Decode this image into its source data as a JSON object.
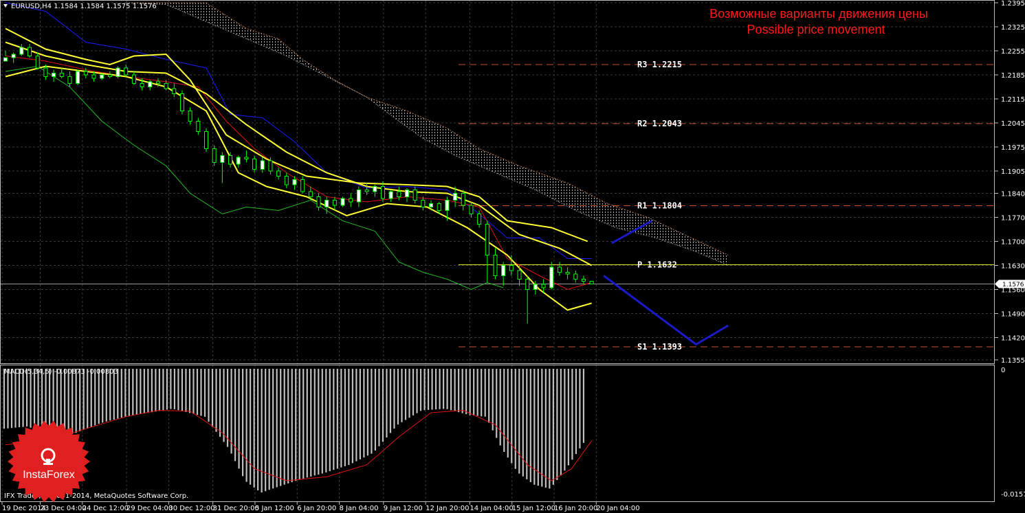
{
  "window": {
    "symbol_title": "EURUSD,H4  1.1584 1.1584 1.1575 1.1576",
    "copyright": "IFX Trader, © 2001-2014, MetaQuotes Software Corp."
  },
  "annotation": {
    "line_ru": "Возможные варианты движения цены",
    "line_en": "Possible price movement"
  },
  "logo": {
    "text": "InstaForex"
  },
  "chart_data": [
    {
      "type": "candlestick",
      "title": "EURUSD,H4  1.1584 1.1584 1.1575 1.1576",
      "x_tick_labels": [
        "19 Dec 2014",
        "23 Dec 04:00",
        "24 Dec 12:00",
        "29 Dec 04:00",
        "30 Dec 12:00",
        "31 Dec 20:00",
        "5 Jan 12:00",
        "6 Jan 20:00",
        "8 Jan 04:00",
        "9 Jan 12:00",
        "12 Jan 20:00",
        "14 Jan 04:00",
        "15 Jan 12:00",
        "16 Jan 20:00",
        "20 Jan 04:00"
      ],
      "y_tick_labels": [
        "1.2395",
        "1.2325",
        "1.2255",
        "1.2185",
        "1.2115",
        "1.2045",
        "1.1975",
        "1.1905",
        "1.1840",
        "1.1770",
        "1.1700",
        "1.1630",
        "1.1560",
        "1.1490",
        "1.1420",
        "1.1355"
      ],
      "ylim": [
        1.1355,
        1.2395
      ],
      "current_price": {
        "label": "1.1576",
        "value": 1.1576,
        "color": "#ffffff"
      },
      "pivot_levels": [
        {
          "label": "R3  1.2215",
          "value": 1.2215,
          "color": "#c8542a",
          "style": "dashed"
        },
        {
          "label": "R2  1.2043",
          "value": 1.2043,
          "color": "#c8542a",
          "style": "dashed"
        },
        {
          "label": "R1  1.1804",
          "value": 1.1804,
          "color": "#c8542a",
          "style": "dashed"
        },
        {
          "label": "P  1.1632",
          "value": 1.1632,
          "color": "#e6e62a",
          "style": "solid"
        },
        {
          "label": "S1  1.1393",
          "value": 1.1393,
          "color": "#c8542a",
          "style": "dashed"
        }
      ],
      "colors": {
        "bull": "#00ff00",
        "bear": "#00ff00",
        "wick": "#00ff00",
        "bollinger": "#ffff33",
        "tenkan": "#e01010",
        "kijun": "#1a1aff",
        "chikou": "#22bb22",
        "cloud": "#c8c8c8",
        "forecast": "#1a1acc",
        "grid": "#3a3a3a"
      },
      "candles": [
        [
          1.2225,
          1.2255,
          1.224,
          1.2235
        ],
        [
          1.2235,
          1.225,
          1.222,
          1.2245
        ],
        [
          1.2245,
          1.2275,
          1.224,
          1.2265
        ],
        [
          1.2265,
          1.2275,
          1.2235,
          1.224
        ],
        [
          1.224,
          1.225,
          1.22,
          1.2205
        ],
        [
          1.2205,
          1.2215,
          1.217,
          1.218
        ],
        [
          1.218,
          1.22,
          1.2165,
          1.219
        ],
        [
          1.219,
          1.2205,
          1.2175,
          1.218
        ],
        [
          1.218,
          1.2195,
          1.215,
          1.216
        ],
        [
          1.216,
          1.22,
          1.2155,
          1.2195
        ],
        [
          1.2195,
          1.2205,
          1.2175,
          1.2185
        ],
        [
          1.2185,
          1.2195,
          1.2165,
          1.2175
        ],
        [
          1.2175,
          1.219,
          1.217,
          1.2185
        ],
        [
          1.2185,
          1.2195,
          1.2175,
          1.218
        ],
        [
          1.218,
          1.221,
          1.2175,
          1.2205
        ],
        [
          1.2205,
          1.2215,
          1.218,
          1.2185
        ],
        [
          1.2185,
          1.2195,
          1.2155,
          1.216
        ],
        [
          1.216,
          1.2175,
          1.214,
          1.215
        ],
        [
          1.215,
          1.217,
          1.214,
          1.2165
        ],
        [
          1.2165,
          1.2175,
          1.215,
          1.216
        ],
        [
          1.216,
          1.217,
          1.214,
          1.2145
        ],
        [
          1.2145,
          1.216,
          1.212,
          1.213
        ],
        [
          1.213,
          1.214,
          1.207,
          1.208
        ],
        [
          1.208,
          1.209,
          1.204,
          1.205
        ],
        [
          1.205,
          1.206,
          1.201,
          1.202
        ],
        [
          1.202,
          1.203,
          1.196,
          1.197
        ],
        [
          1.197,
          1.198,
          1.192,
          1.193
        ],
        [
          1.193,
          1.196,
          1.187,
          1.195
        ],
        [
          1.195,
          1.196,
          1.1915,
          1.1925
        ],
        [
          1.1925,
          1.195,
          1.1915,
          1.1945
        ],
        [
          1.1945,
          1.1965,
          1.193,
          1.194
        ],
        [
          1.194,
          1.195,
          1.19,
          1.191
        ],
        [
          1.191,
          1.1945,
          1.19,
          1.1935
        ],
        [
          1.1935,
          1.1945,
          1.1895,
          1.1905
        ],
        [
          1.1905,
          1.1915,
          1.188,
          1.189
        ],
        [
          1.189,
          1.19,
          1.1855,
          1.1865
        ],
        [
          1.1865,
          1.189,
          1.185,
          1.188
        ],
        [
          1.188,
          1.189,
          1.184,
          1.1845
        ],
        [
          1.1845,
          1.186,
          1.182,
          1.183
        ],
        [
          1.183,
          1.184,
          1.179,
          1.18
        ],
        [
          1.18,
          1.183,
          1.178,
          1.182
        ],
        [
          1.182,
          1.183,
          1.179,
          1.1805
        ],
        [
          1.1805,
          1.183,
          1.18,
          1.1825
        ],
        [
          1.1825,
          1.184,
          1.18,
          1.1815
        ],
        [
          1.1815,
          1.186,
          1.18,
          1.185
        ],
        [
          1.185,
          1.187,
          1.1835,
          1.1845
        ],
        [
          1.1845,
          1.1865,
          1.183,
          1.186
        ],
        [
          1.186,
          1.1875,
          1.1815,
          1.1825
        ],
        [
          1.1825,
          1.185,
          1.1815,
          1.1845
        ],
        [
          1.1845,
          1.186,
          1.182,
          1.183
        ],
        [
          1.183,
          1.1855,
          1.1815,
          1.185
        ],
        [
          1.185,
          1.186,
          1.181,
          1.182
        ],
        [
          1.182,
          1.183,
          1.179,
          1.18
        ],
        [
          1.18,
          1.182,
          1.179,
          1.181
        ],
        [
          1.181,
          1.1815,
          1.178,
          1.179
        ],
        [
          1.179,
          1.183,
          1.176,
          1.182
        ],
        [
          1.182,
          1.186,
          1.18,
          1.184
        ],
        [
          1.184,
          1.185,
          1.179,
          1.1805
        ],
        [
          1.1805,
          1.1815,
          1.177,
          1.178
        ],
        [
          1.178,
          1.179,
          1.174,
          1.175
        ],
        [
          1.175,
          1.176,
          1.158,
          1.166
        ],
        [
          1.166,
          1.168,
          1.159,
          1.16
        ],
        [
          1.16,
          1.164,
          1.157,
          1.163
        ],
        [
          1.163,
          1.166,
          1.16,
          1.1615
        ],
        [
          1.1615,
          1.163,
          1.157,
          1.159
        ],
        [
          1.159,
          1.16,
          1.146,
          1.156
        ],
        [
          1.156,
          1.1585,
          1.1545,
          1.1575
        ],
        [
          1.1575,
          1.159,
          1.155,
          1.1565
        ],
        [
          1.1565,
          1.164,
          1.156,
          1.1625
        ],
        [
          1.1625,
          1.164,
          1.16,
          1.161
        ],
        [
          1.161,
          1.1625,
          1.159,
          1.1605
        ],
        [
          1.1605,
          1.1615,
          1.158,
          1.159
        ],
        [
          1.159,
          1.16,
          1.1575,
          1.1584
        ],
        [
          1.1584,
          1.1584,
          1.1575,
          1.1576
        ]
      ],
      "bollinger_upper": [
        [
          0,
          1.232
        ],
        [
          10,
          1.226
        ],
        [
          20,
          1.223
        ],
        [
          26,
          1.2215
        ],
        [
          32,
          1.224
        ],
        [
          40,
          1.2245
        ],
        [
          46,
          1.217
        ],
        [
          55,
          1.201
        ],
        [
          65,
          1.194
        ],
        [
          75,
          1.189
        ],
        [
          88,
          1.187
        ],
        [
          100,
          1.1865
        ],
        [
          110,
          1.186
        ],
        [
          118,
          1.183
        ],
        [
          125,
          1.176
        ],
        [
          136,
          1.174
        ],
        [
          145,
          1.17
        ]
      ],
      "bollinger_middle": [
        [
          0,
          1.228
        ],
        [
          10,
          1.224
        ],
        [
          20,
          1.2215
        ],
        [
          30,
          1.2195
        ],
        [
          40,
          1.219
        ],
        [
          50,
          1.213
        ],
        [
          60,
          1.204
        ],
        [
          70,
          1.196
        ],
        [
          80,
          1.19
        ],
        [
          90,
          1.186
        ],
        [
          100,
          1.1845
        ],
        [
          110,
          1.184
        ],
        [
          118,
          1.1805
        ],
        [
          128,
          1.172
        ],
        [
          138,
          1.168
        ],
        [
          146,
          1.163
        ]
      ],
      "bollinger_lower": [
        [
          0,
          1.218
        ],
        [
          10,
          1.221
        ],
        [
          20,
          1.2195
        ],
        [
          30,
          1.218
        ],
        [
          40,
          1.215
        ],
        [
          50,
          1.208
        ],
        [
          58,
          1.19
        ],
        [
          65,
          1.186
        ],
        [
          75,
          1.183
        ],
        [
          85,
          1.1775
        ],
        [
          95,
          1.181
        ],
        [
          105,
          1.18
        ],
        [
          115,
          1.174
        ],
        [
          125,
          1.166
        ],
        [
          133,
          1.156
        ],
        [
          140,
          1.15
        ],
        [
          146,
          1.152
        ]
      ],
      "tenkan": [
        [
          0,
          1.224
        ],
        [
          10,
          1.2225
        ],
        [
          20,
          1.22
        ],
        [
          30,
          1.218
        ],
        [
          40,
          1.2165
        ],
        [
          48,
          1.215
        ],
        [
          55,
          1.205
        ],
        [
          62,
          1.197
        ],
        [
          70,
          1.19
        ],
        [
          80,
          1.183
        ],
        [
          90,
          1.1815
        ],
        [
          100,
          1.183
        ],
        [
          110,
          1.182
        ],
        [
          118,
          1.18
        ],
        [
          125,
          1.165
        ],
        [
          133,
          1.16
        ],
        [
          140,
          1.156
        ],
        [
          146,
          1.158
        ]
      ],
      "kijun": [
        [
          0,
          1.2395
        ],
        [
          10,
          1.237
        ],
        [
          20,
          1.228
        ],
        [
          30,
          1.226
        ],
        [
          40,
          1.223
        ],
        [
          50,
          1.2205
        ],
        [
          56,
          1.207
        ],
        [
          64,
          1.206
        ],
        [
          72,
          1.199
        ],
        [
          80,
          1.19
        ],
        [
          90,
          1.1855
        ],
        [
          100,
          1.186
        ],
        [
          110,
          1.185
        ],
        [
          118,
          1.178
        ],
        [
          125,
          1.171
        ],
        [
          133,
          1.171
        ],
        [
          140,
          1.165
        ],
        [
          146,
          1.165
        ]
      ],
      "chikou": [
        [
          0,
          1.2195
        ],
        [
          8,
          1.221
        ],
        [
          16,
          1.215
        ],
        [
          24,
          1.205
        ],
        [
          32,
          1.198
        ],
        [
          40,
          1.192
        ],
        [
          46,
          1.184
        ],
        [
          54,
          1.178
        ],
        [
          60,
          1.18
        ],
        [
          68,
          1.179
        ],
        [
          76,
          1.182
        ],
        [
          84,
          1.176
        ],
        [
          92,
          1.173
        ],
        [
          98,
          1.164
        ],
        [
          104,
          1.161
        ],
        [
          110,
          1.159
        ],
        [
          116,
          1.156
        ],
        [
          120,
          1.158
        ],
        [
          124,
          1.1565
        ]
      ],
      "cloud_top": [
        [
          30,
          1.2395
        ],
        [
          50,
          1.2395
        ],
        [
          60,
          1.232
        ],
        [
          68,
          1.229
        ],
        [
          74,
          1.223
        ],
        [
          82,
          1.217
        ],
        [
          90,
          1.212
        ],
        [
          100,
          1.208
        ],
        [
          110,
          1.203
        ],
        [
          118,
          1.197
        ],
        [
          128,
          1.192
        ],
        [
          140,
          1.187
        ],
        [
          150,
          1.181
        ],
        [
          160,
          1.177
        ],
        [
          170,
          1.1715
        ],
        [
          180,
          1.166
        ]
      ],
      "cloud_bottom": [
        [
          30,
          1.2395
        ],
        [
          40,
          1.239
        ],
        [
          50,
          1.234
        ],
        [
          60,
          1.229
        ],
        [
          70,
          1.224
        ],
        [
          80,
          1.218
        ],
        [
          90,
          1.212
        ],
        [
          98,
          1.205
        ],
        [
          104,
          1.2
        ],
        [
          112,
          1.195
        ],
        [
          122,
          1.19
        ],
        [
          132,
          1.185
        ],
        [
          142,
          1.179
        ],
        [
          152,
          1.174
        ],
        [
          162,
          1.171
        ],
        [
          172,
          1.167
        ],
        [
          180,
          1.163
        ]
      ],
      "forecast_up": [
        [
          151,
          1.1695
        ],
        [
          161,
          1.176
        ]
      ],
      "forecast_down": [
        [
          149,
          1.16
        ],
        [
          172,
          1.14
        ],
        [
          180,
          1.1455
        ]
      ]
    },
    {
      "type": "bar",
      "title": "MACD(5,34,5) -0.00873 -0.00803",
      "y_tick_labels": [
        "0",
        "-0.01572"
      ],
      "ylim": [
        -0.01572,
        0
      ],
      "colors": {
        "bars": "#c0c0c0",
        "signal": "#e01010"
      },
      "histogram": [
        [
          0,
          -0.0075
        ],
        [
          6,
          -0.0072
        ],
        [
          12,
          -0.0088
        ],
        [
          18,
          -0.008
        ],
        [
          24,
          -0.0068
        ],
        [
          30,
          -0.006
        ],
        [
          36,
          -0.0055
        ],
        [
          42,
          -0.005
        ],
        [
          50,
          -0.006
        ],
        [
          56,
          -0.01
        ],
        [
          60,
          -0.014
        ],
        [
          64,
          -0.0155
        ],
        [
          68,
          -0.0148
        ],
        [
          74,
          -0.0138
        ],
        [
          80,
          -0.013
        ],
        [
          86,
          -0.012
        ],
        [
          92,
          -0.0105
        ],
        [
          98,
          -0.007
        ],
        [
          104,
          -0.0052
        ],
        [
          110,
          -0.005
        ],
        [
          116,
          -0.0058
        ],
        [
          120,
          -0.006
        ],
        [
          124,
          -0.01
        ],
        [
          128,
          -0.013
        ],
        [
          132,
          -0.0145
        ],
        [
          136,
          -0.015
        ],
        [
          140,
          -0.0125
        ],
        [
          144,
          -0.0095
        ],
        [
          145,
          -0.0088
        ]
      ],
      "signal": [
        [
          0,
          -0.0095
        ],
        [
          10,
          -0.009
        ],
        [
          20,
          -0.0075
        ],
        [
          30,
          -0.006
        ],
        [
          38,
          -0.0052
        ],
        [
          46,
          -0.0053
        ],
        [
          54,
          -0.008
        ],
        [
          62,
          -0.0125
        ],
        [
          70,
          -0.014
        ],
        [
          80,
          -0.0135
        ],
        [
          90,
          -0.012
        ],
        [
          98,
          -0.0085
        ],
        [
          106,
          -0.0055
        ],
        [
          114,
          -0.0052
        ],
        [
          122,
          -0.007
        ],
        [
          130,
          -0.012
        ],
        [
          136,
          -0.014
        ],
        [
          141,
          -0.0125
        ],
        [
          146,
          -0.009
        ]
      ]
    }
  ]
}
